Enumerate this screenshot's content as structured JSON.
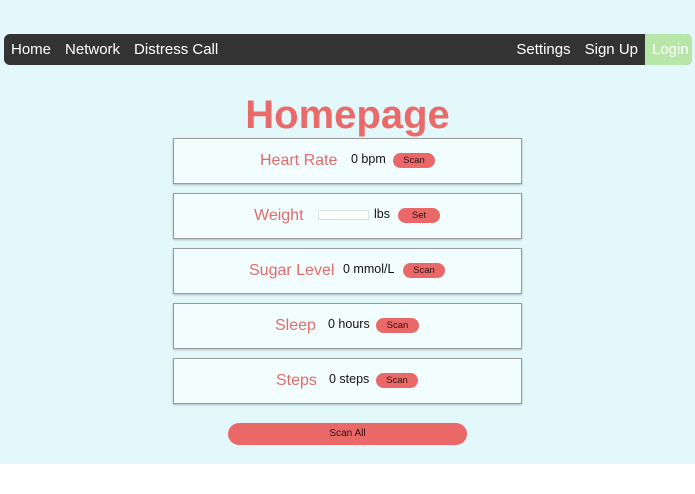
{
  "nav": {
    "home": "Home",
    "network": "Network",
    "distress_call": "Distress Call",
    "settings": "Settings",
    "sign_up": "Sign Up",
    "login": "Login"
  },
  "page_title": "Homepage",
  "cards": {
    "heart_rate": {
      "label": "Heart Rate",
      "value": "0 bpm",
      "button": "Scan"
    },
    "weight": {
      "label": "Weight",
      "input_value": "",
      "unit": "lbs",
      "button": "Set"
    },
    "sugar_level": {
      "label": "Sugar Level",
      "value": "0 mmol/L",
      "button": "Scan"
    },
    "sleep": {
      "label": "Sleep",
      "value": "0 hours",
      "button": "Scan"
    },
    "steps": {
      "label": "Steps",
      "value": "0 steps",
      "button": "Scan"
    }
  },
  "scan_all_label": "Scan All",
  "colors": {
    "background": "#e3f8fb",
    "navbar": "#333333",
    "login_bg": "#b8e6a8",
    "accent": "#ea6868"
  }
}
